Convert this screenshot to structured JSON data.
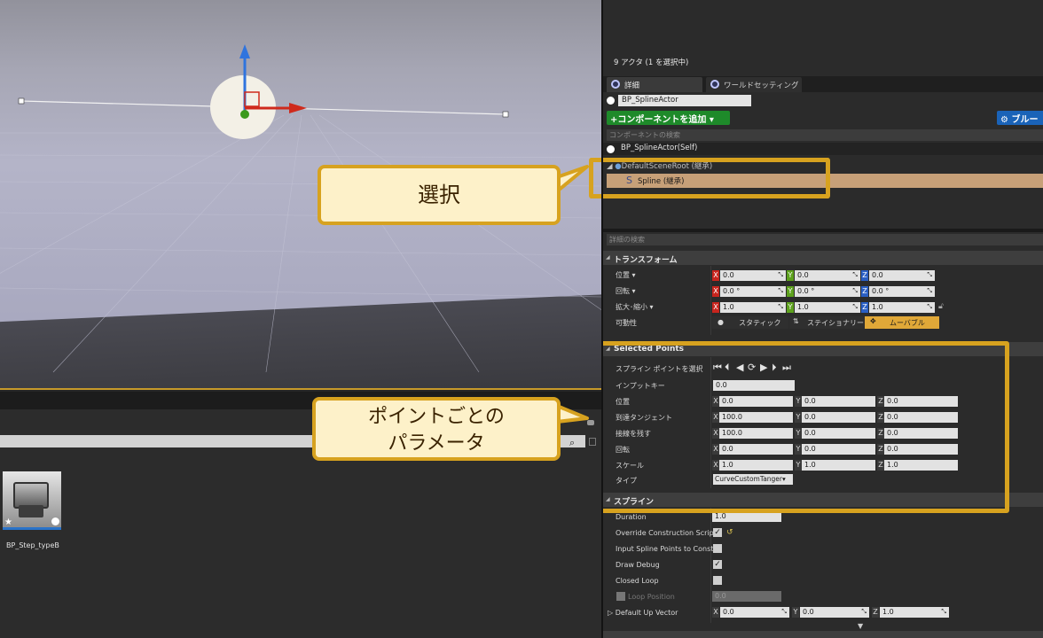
{
  "viewport": {},
  "content_browser": {
    "asset_name": "BP_Step_typeB"
  },
  "details_panel": {
    "actor_count": "9 アクタ (1 を選択中)",
    "tabs": [
      "詳細",
      "ワールドセッティング"
    ],
    "actor_name": "BP_SplineActor",
    "add_component_label": "+コンポーネントを追加 ▾",
    "blueprint_label": "ブルー",
    "component_search_placeholder": "コンポーネントの検索",
    "self_label": "BP_SplineActor(Self)",
    "root_label": "DefaultSceneRoot (継承)",
    "spline_label": "Spline (継承)",
    "details_search_placeholder": "詳細の検索",
    "transform": {
      "header": "トランスフォーム",
      "location_label": "位置 ▾",
      "rotation_label": "回転 ▾",
      "scale_label": "拡大･縮小 ▾",
      "mobility_label": "可動性",
      "location": [
        "0.0",
        "0.0",
        "0.0"
      ],
      "rotation": [
        "0.0 °",
        "0.0 °",
        "0.0 °"
      ],
      "scale": [
        "1.0",
        "1.0",
        "1.0"
      ],
      "mobility_options": [
        "スタティック",
        "ステイショナリー",
        "ムーバブル"
      ],
      "mobility_selected": "ムーバブル"
    },
    "selected_points": {
      "header": "Selected Points",
      "select_label": "スプライン ポイントを選択",
      "input_key_label": "インプットキー",
      "input_key": "0.0",
      "rows": [
        {
          "label": "位置",
          "values": [
            "0.0",
            "0.0",
            "0.0"
          ]
        },
        {
          "label": "到達タンジェント",
          "values": [
            "100.0",
            "0.0",
            "0.0"
          ]
        },
        {
          "label": "接線を残す",
          "values": [
            "100.0",
            "0.0",
            "0.0"
          ]
        },
        {
          "label": "回転",
          "values": [
            "0.0",
            "0.0",
            "0.0"
          ]
        },
        {
          "label": "スケール",
          "values": [
            "1.0",
            "1.0",
            "1.0"
          ]
        }
      ],
      "type_label": "タイプ",
      "type_value": "CurveCustomTanger▾"
    },
    "spline": {
      "header": "スプライン",
      "duration_label": "Duration",
      "duration": "1.0",
      "override_label": "Override Construction Script",
      "override_checked": true,
      "input_points_label": "Input Spline Points to Constr",
      "input_points_checked": false,
      "draw_debug_label": "Draw Debug",
      "draw_debug_checked": true,
      "closed_loop_label": "Closed Loop",
      "closed_loop_checked": false,
      "loop_position_label": "Loop Position",
      "loop_position": "0.0",
      "up_vector_label": "Default Up Vector",
      "up_vector": [
        "0.0",
        "0.0",
        "1.0"
      ]
    }
  },
  "annotations": {
    "select_callout": "選択",
    "params_callout": "ポイントごとの\nパラメータ"
  },
  "colors": {
    "highlight": "#d7a21f",
    "callout_fill": "#fdf1c9",
    "selection": "#c7a078",
    "add_button": "#1e8a2a"
  }
}
